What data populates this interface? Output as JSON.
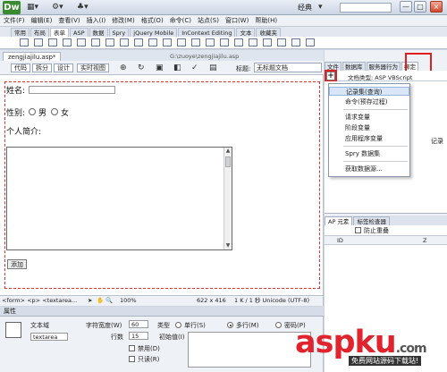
{
  "window": {
    "app_logo": "Dw",
    "preset": "经典",
    "controls": [
      "—",
      "□",
      "×"
    ]
  },
  "menu": [
    "文件(F)",
    "编辑(E)",
    "查看(V)",
    "插入(I)",
    "修改(M)",
    "格式(O)",
    "命令(C)",
    "站点(S)",
    "窗口(W)",
    "帮助(H)"
  ],
  "insert_tabs": [
    "常用",
    "布局",
    "表单",
    "ASP",
    "数据",
    "Spry",
    "jQuery Mobile",
    "InContext Editing",
    "文本",
    "收藏夹"
  ],
  "insert_active": 2,
  "document": {
    "tab": "zengjiajilu.asp*",
    "path": "G:\\zuoye\\zengjiajilu.asp",
    "view_buttons": [
      "代码",
      "拆分",
      "设计",
      "实时视图"
    ],
    "title_label": "标题:",
    "title_value": "无标题文档"
  },
  "form": {
    "name_label": "姓名:",
    "gender_label": "性别:",
    "male": "男",
    "female": "女",
    "intro_label": "个人简介:",
    "submit_label": "添加"
  },
  "status": {
    "tag_path": "<form> <p> <textarea...",
    "zoom": "100%",
    "size": "622 x 416",
    "file_info": "1 K / 1 秒 Unicode (UTF-8)"
  },
  "properties": {
    "header": "属性",
    "type_label": "文本域",
    "name_value": "textarea",
    "char_width_label": "字符宽度(W)",
    "char_width_value": "60",
    "lines_label": "行数",
    "lines_value": "15",
    "init_label": "初始值(I)",
    "kind_label": "类型",
    "single": "单行(S)",
    "multi": "多行(M)",
    "password": "密码(P)",
    "disabled": "禁用(D)",
    "readonly": "只读(R)"
  },
  "right_panel": {
    "tabs": [
      "文件",
      "数据库",
      "服务器行为",
      "绑定"
    ],
    "doc_type_label": "文档类型:",
    "doc_type_value": "ASP VBScript",
    "side_text": "记录",
    "bottom_tabs": [
      "AP 元素",
      "标签检查器"
    ],
    "prevent_overlap": "防止重叠",
    "col_id": "ID",
    "col_z": "Z"
  },
  "dropdown": {
    "items": [
      "记录集(查询)",
      "命令(预存过程)",
      "请求变量",
      "阶段变量",
      "应用程序变量",
      "Spry 数据集",
      "获取数据源..."
    ],
    "highlighted": 0
  },
  "watermark": {
    "brand": "aspku",
    "tld": ".com",
    "tagline": "免费网站源码下载站!"
  }
}
